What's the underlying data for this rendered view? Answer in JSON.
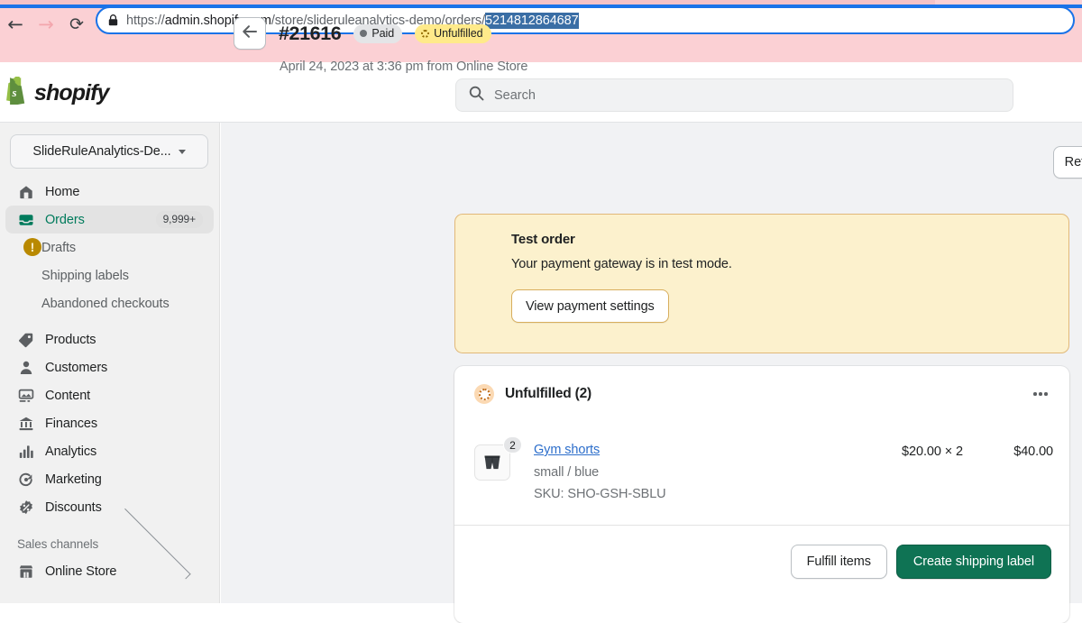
{
  "browser": {
    "back_icon": "back-arrow-icon",
    "forward_icon": "forward-arrow-icon",
    "reload_icon": "reload-icon",
    "lock_icon": "lock-icon",
    "url_scheme": "https://",
    "url_host": "admin.shopify.com",
    "url_path": "/store/slideruleanalytics-demo/orders/",
    "url_selected_segment": "5214812864687",
    "url_full": "https://admin.shopify.com/store/slideruleanalytics-demo/orders/5214812864687"
  },
  "topbar": {
    "brand": "shopify",
    "logo_icon": "shopify-bag-icon",
    "search": {
      "icon": "search-icon",
      "placeholder": "Search",
      "value": ""
    }
  },
  "sidebar": {
    "store_switcher": {
      "label": "SlideRuleAnalytics-De...",
      "caret_icon": "chevron-down-icon"
    },
    "items": [
      {
        "label": "Home",
        "icon": "home-icon",
        "active": false,
        "badge": ""
      },
      {
        "label": "Orders",
        "icon": "orders-inbox-icon",
        "active": true,
        "badge": "9,999+"
      },
      {
        "label": "Products",
        "icon": "products-tag-icon",
        "active": false,
        "badge": ""
      },
      {
        "label": "Customers",
        "icon": "customers-person-icon",
        "active": false,
        "badge": ""
      },
      {
        "label": "Content",
        "icon": "content-image-icon",
        "active": false,
        "badge": ""
      },
      {
        "label": "Finances",
        "icon": "finances-bank-icon",
        "active": false,
        "badge": ""
      },
      {
        "label": "Analytics",
        "icon": "analytics-bars-icon",
        "active": false,
        "badge": ""
      },
      {
        "label": "Marketing",
        "icon": "marketing-megaphone-icon",
        "active": false,
        "badge": ""
      },
      {
        "label": "Discounts",
        "icon": "discounts-percent-icon",
        "active": false,
        "badge": ""
      }
    ],
    "subitems": [
      {
        "label": "Drafts"
      },
      {
        "label": "Shipping labels"
      },
      {
        "label": "Abandoned checkouts"
      }
    ],
    "sales_channels": {
      "label": "Sales channels",
      "chevron_icon": "chevron-right-icon"
    },
    "online_store": {
      "label": "Online Store",
      "icon": "online-store-icon"
    }
  },
  "order": {
    "back_icon": "back-arrow-icon",
    "number": "#21616",
    "badges": [
      {
        "label": "Paid",
        "style": "paid",
        "icon": "filled-dot-icon"
      },
      {
        "label": "Unfulfilled",
        "style": "unfulfilled",
        "icon": "dashed-circle-icon"
      }
    ],
    "timestamp": "April 24, 2023 at 3:36 pm from Online Store",
    "refund_label": "Refund"
  },
  "test_order_banner": {
    "icon": "warning-exclamation-icon",
    "icon_glyph": "!",
    "title": "Test order",
    "body": "Your payment gateway is in test mode.",
    "button_label": "View payment settings"
  },
  "unfulfilled_card": {
    "status_icon": "unfulfilled-dashed-circle-icon",
    "title": "Unfulfilled (2)",
    "more_icon": "kebab-menu-icon",
    "line_items": [
      {
        "thumb_icon": "gym-shorts-thumbnail",
        "quantity_badge": "2",
        "title": "Gym shorts",
        "variant": "small / blue",
        "sku": "SKU: SHO-GSH-SBLU",
        "unit_price": "$20.00 × 2",
        "total": "$40.00"
      }
    ],
    "actions": {
      "fulfill_label": "Fulfill items",
      "create_label_label": "Create shipping label"
    }
  },
  "colors": {
    "brand_green": "#0f7354",
    "active_nav_green": "#007b5c",
    "link_blue": "#2c6ecb",
    "banner_bg": "#fcf1cd",
    "banner_border": "#e1b878",
    "badge_yellow": "#ffea8a",
    "chrome_pink": "#fbd0d4",
    "focus_blue": "#1a73e8"
  }
}
